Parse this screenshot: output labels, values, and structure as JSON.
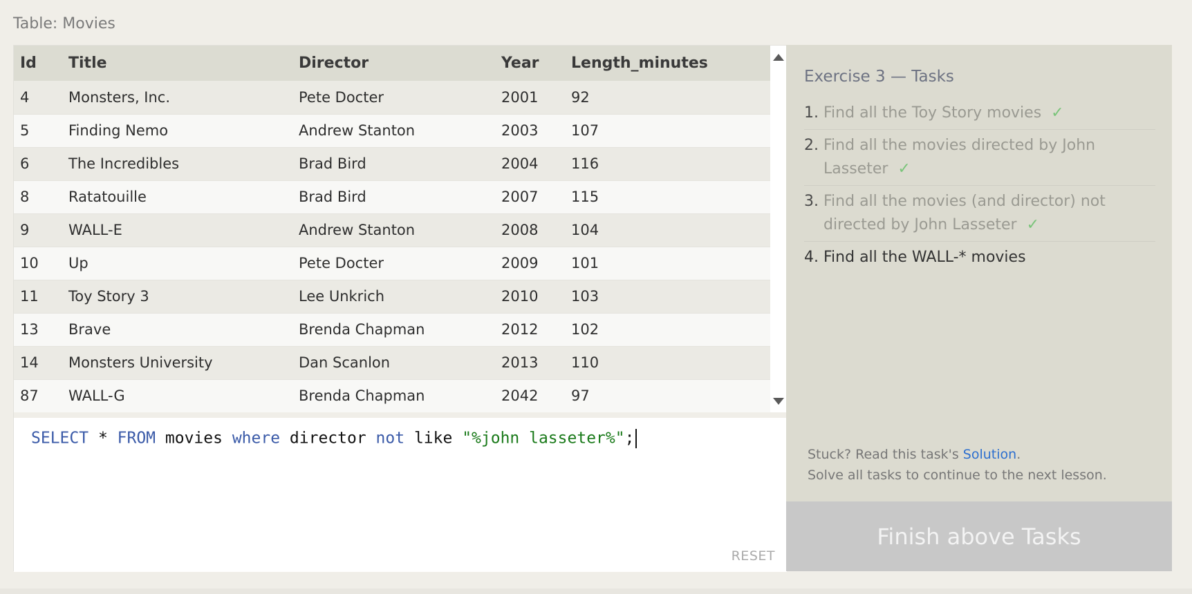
{
  "table_caption": "Table: Movies",
  "table": {
    "columns": [
      "Id",
      "Title",
      "Director",
      "Year",
      "Length_minutes"
    ],
    "rows": [
      [
        "4",
        "Monsters, Inc.",
        "Pete Docter",
        "2001",
        "92"
      ],
      [
        "5",
        "Finding Nemo",
        "Andrew Stanton",
        "2003",
        "107"
      ],
      [
        "6",
        "The Incredibles",
        "Brad Bird",
        "2004",
        "116"
      ],
      [
        "8",
        "Ratatouille",
        "Brad Bird",
        "2007",
        "115"
      ],
      [
        "9",
        "WALL-E",
        "Andrew Stanton",
        "2008",
        "104"
      ],
      [
        "10",
        "Up",
        "Pete Docter",
        "2009",
        "101"
      ],
      [
        "11",
        "Toy Story 3",
        "Lee Unkrich",
        "2010",
        "103"
      ],
      [
        "13",
        "Brave",
        "Brenda Chapman",
        "2012",
        "102"
      ],
      [
        "14",
        "Monsters University",
        "Dan Scanlon",
        "2013",
        "110"
      ],
      [
        "87",
        "WALL-G",
        "Brenda Chapman",
        "2042",
        "97"
      ]
    ]
  },
  "editor": {
    "tokens": [
      {
        "text": "SELECT",
        "kind": "kw"
      },
      {
        "text": " * ",
        "kind": "plain"
      },
      {
        "text": "FROM",
        "kind": "kw"
      },
      {
        "text": " movies ",
        "kind": "plain"
      },
      {
        "text": "where",
        "kind": "kw"
      },
      {
        "text": " director ",
        "kind": "plain"
      },
      {
        "text": "not",
        "kind": "kw"
      },
      {
        "text": " like ",
        "kind": "plain"
      },
      {
        "text": "\"%john lasseter%\"",
        "kind": "str"
      },
      {
        "text": ";",
        "kind": "plain"
      }
    ],
    "reset_label": "RESET"
  },
  "exercise": {
    "title": "Exercise 3 — Tasks",
    "tasks": [
      {
        "num": "1.",
        "text": "Find all the Toy Story movies",
        "done": true
      },
      {
        "num": "2.",
        "text": "Find all the movies directed by John Lasseter",
        "done": true
      },
      {
        "num": "3.",
        "text": "Find all the movies (and director) not directed by John Lasseter",
        "done": true
      },
      {
        "num": "4.",
        "text": "Find all the WALL-* movies",
        "done": false
      }
    ],
    "check_glyph": "✓",
    "help_prefix": "Stuck? Read this task's ",
    "help_link": "Solution",
    "help_suffix": ".",
    "help_line2": "Solve all tasks to continue to the next lesson.",
    "finish_label": "Finish above Tasks"
  },
  "colors": {
    "keyword": "#3a5aa8",
    "string": "#1a7a1a",
    "check": "#7ac47a",
    "link": "#2c6fcf"
  }
}
